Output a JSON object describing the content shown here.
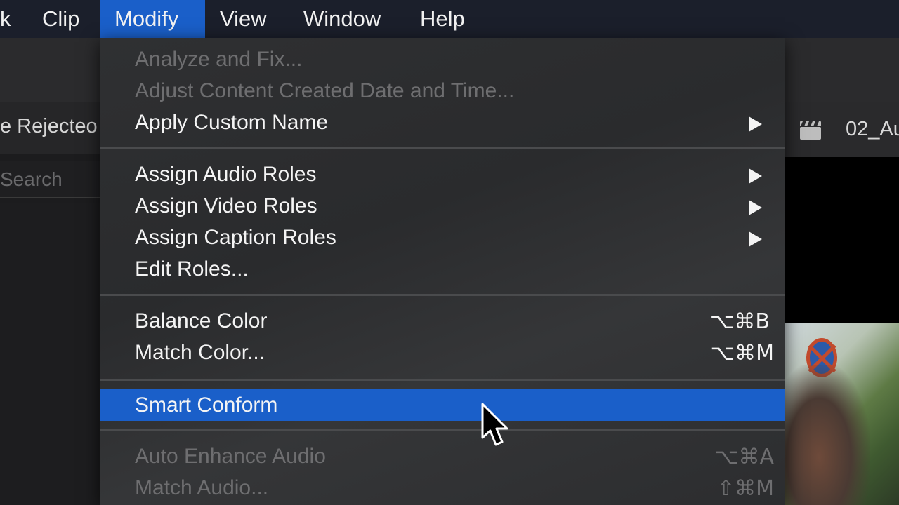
{
  "menubar": {
    "items": [
      {
        "label": "k",
        "active": false
      },
      {
        "label": "Clip",
        "active": false
      },
      {
        "label": "Modify",
        "active": true
      },
      {
        "label": "View",
        "active": false
      },
      {
        "label": "Window",
        "active": false
      },
      {
        "label": "Help",
        "active": false
      }
    ]
  },
  "browser": {
    "filter_label": "e Rejecteo",
    "search_placeholder": "Search"
  },
  "viewer": {
    "clip_name": "02_Au"
  },
  "menu": {
    "items": [
      {
        "label": "Analyze and Fix...",
        "enabled": false,
        "submenu": false,
        "shortcut": ""
      },
      {
        "label": "Adjust Content Created Date and Time...",
        "enabled": false,
        "submenu": false,
        "shortcut": ""
      },
      {
        "label": "Apply Custom Name",
        "enabled": true,
        "submenu": true,
        "shortcut": ""
      },
      {
        "label": "Assign Audio Roles",
        "enabled": true,
        "submenu": true,
        "shortcut": ""
      },
      {
        "label": "Assign Video Roles",
        "enabled": true,
        "submenu": true,
        "shortcut": ""
      },
      {
        "label": "Assign Caption Roles",
        "enabled": true,
        "submenu": true,
        "shortcut": ""
      },
      {
        "label": "Edit Roles...",
        "enabled": true,
        "submenu": false,
        "shortcut": ""
      },
      {
        "label": "Balance Color",
        "enabled": true,
        "submenu": false,
        "shortcut": "⌥⌘B"
      },
      {
        "label": "Match Color...",
        "enabled": true,
        "submenu": false,
        "shortcut": "⌥⌘M"
      },
      {
        "label": "Smart Conform",
        "enabled": true,
        "submenu": false,
        "shortcut": "",
        "highlighted": true
      },
      {
        "label": "Auto Enhance Audio",
        "enabled": false,
        "submenu": false,
        "shortcut": "⌥⌘A"
      },
      {
        "label": "Match Audio...",
        "enabled": false,
        "submenu": false,
        "shortcut": "⇧⌘M"
      }
    ]
  },
  "colors": {
    "menubar_bg": "#1b1f2b",
    "accent": "#1a5fc9",
    "menu_bg": "#2f3032",
    "disabled_text": "#6e6e70"
  }
}
